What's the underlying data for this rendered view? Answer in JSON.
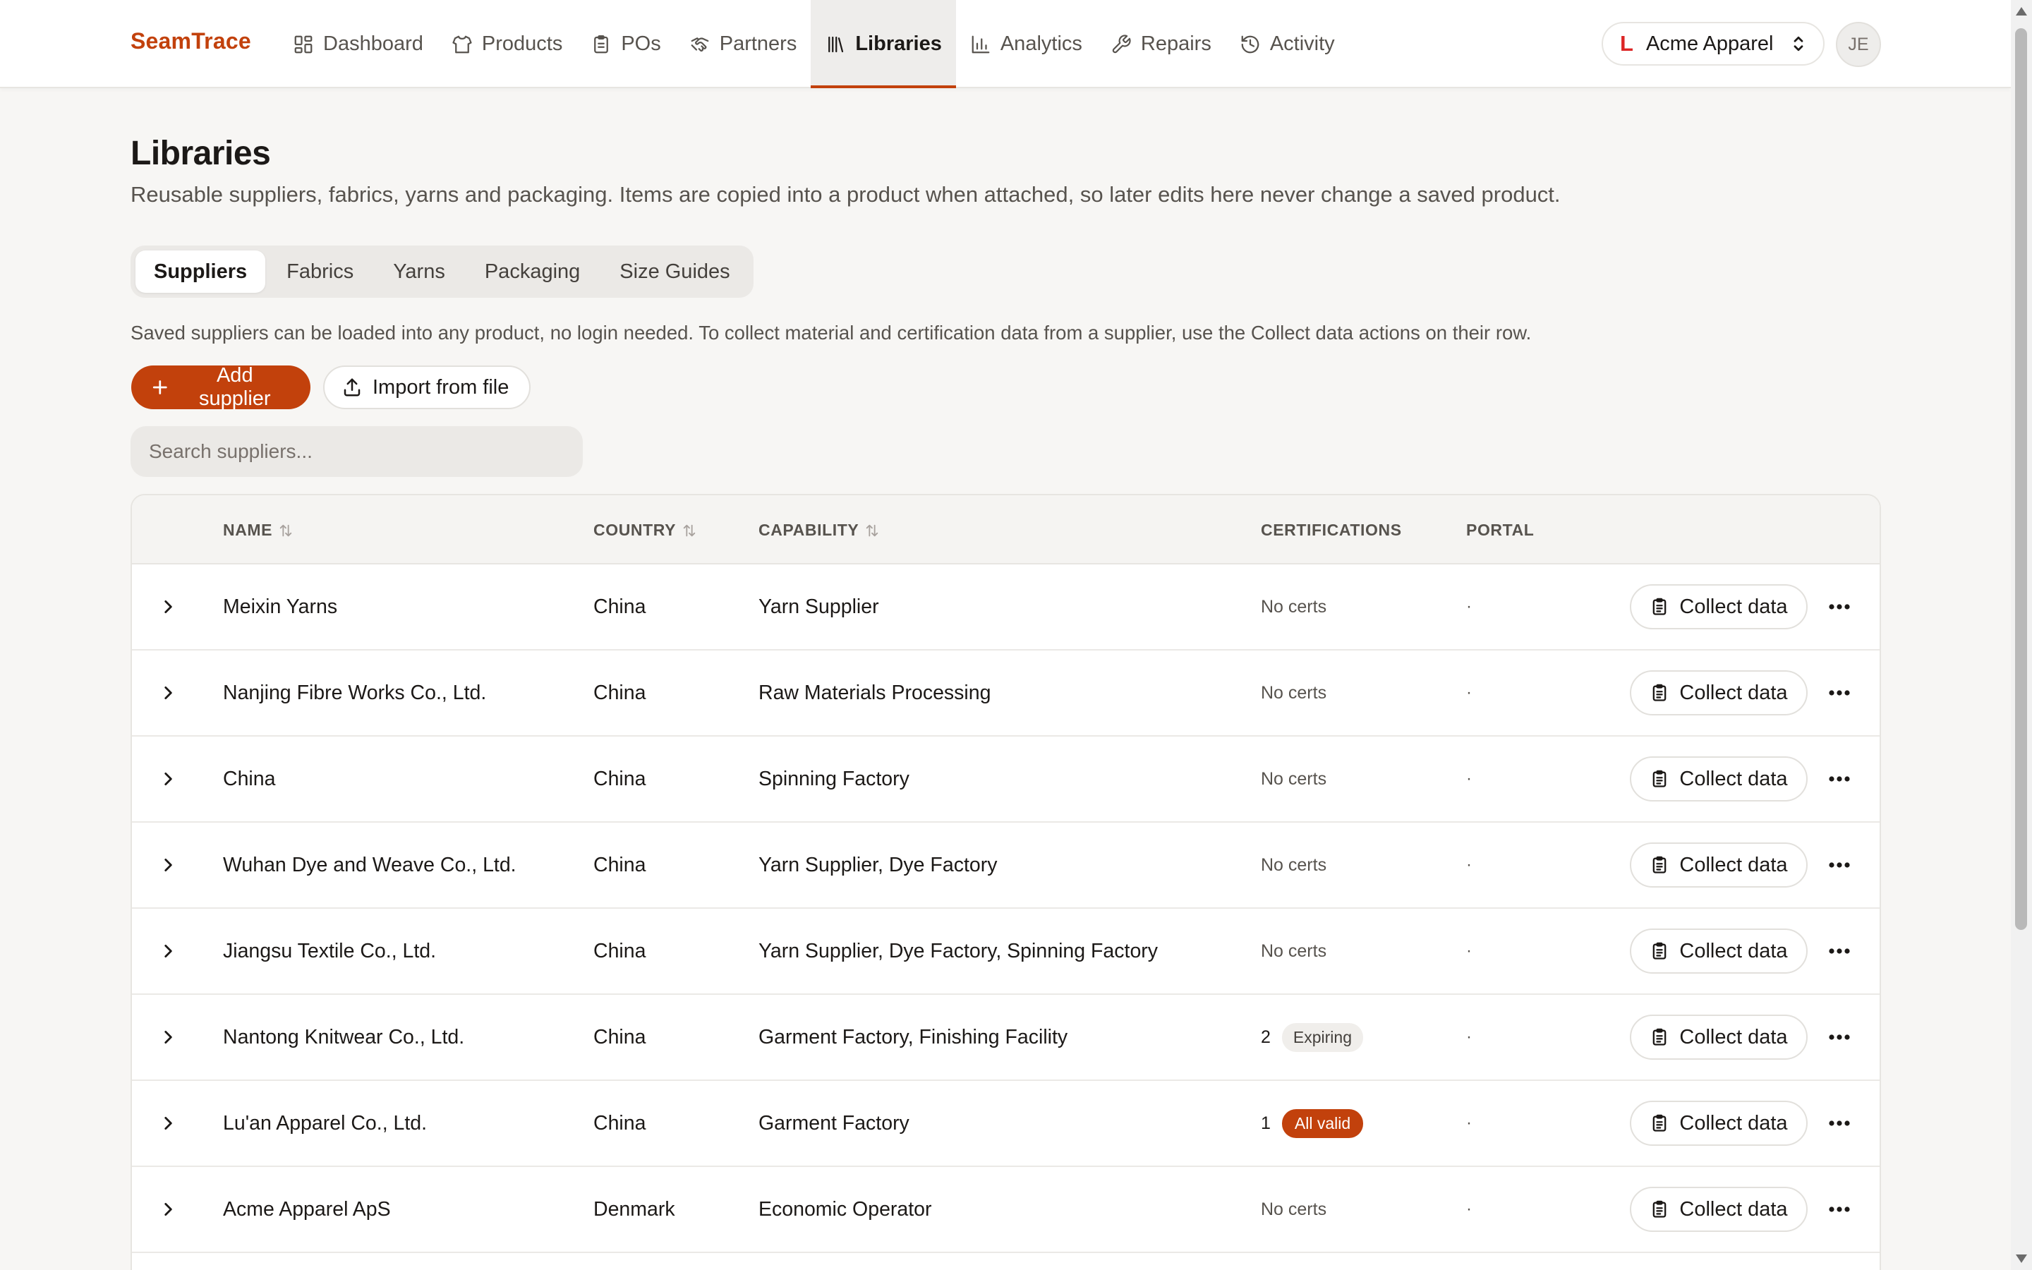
{
  "brand": "SeamTrace",
  "nav": [
    {
      "label": "Dashboard",
      "icon": "dashboard-icon",
      "active": false
    },
    {
      "label": "Products",
      "icon": "shirt-icon",
      "active": false
    },
    {
      "label": "POs",
      "icon": "clipboard-icon",
      "active": false
    },
    {
      "label": "Partners",
      "icon": "handshake-icon",
      "active": false
    },
    {
      "label": "Libraries",
      "icon": "library-icon",
      "active": true
    },
    {
      "label": "Analytics",
      "icon": "bar-chart-icon",
      "active": false
    },
    {
      "label": "Repairs",
      "icon": "wrench-icon",
      "active": false
    },
    {
      "label": "Activity",
      "icon": "history-icon",
      "active": false
    }
  ],
  "org": {
    "logo": "L",
    "name": "Acme Apparel"
  },
  "avatar": "JE",
  "page": {
    "title": "Libraries",
    "subtitle": "Reusable suppliers, fabrics, yarns and packaging. Items are copied into a product when attached, so later edits here never change a saved product."
  },
  "tabs": [
    {
      "label": "Suppliers",
      "active": true
    },
    {
      "label": "Fabrics",
      "active": false
    },
    {
      "label": "Yarns",
      "active": false
    },
    {
      "label": "Packaging",
      "active": false
    },
    {
      "label": "Size Guides",
      "active": false
    }
  ],
  "helper": "Saved suppliers can be loaded into any product, no login needed. To collect material and certification data from a supplier, use the Collect data actions on their row.",
  "actions": {
    "add": "Add supplier",
    "import": "Import from file"
  },
  "search": {
    "placeholder": "Search suppliers..."
  },
  "table": {
    "columns": {
      "name": "NAME",
      "country": "COUNTRY",
      "capability": "CAPABILITY",
      "certifications": "CERTIFICATIONS",
      "portal": "PORTAL"
    },
    "collect_label": "Collect data",
    "rows": [
      {
        "name": "Meixin Yarns",
        "country": "China",
        "capability": "Yarn Supplier",
        "certs": "No certs",
        "cert_count": "",
        "cert_badge": "",
        "badge_style": "",
        "portal": "·"
      },
      {
        "name": "Nanjing Fibre Works Co., Ltd.",
        "country": "China",
        "capability": "Raw Materials Processing",
        "certs": "No certs",
        "cert_count": "",
        "cert_badge": "",
        "badge_style": "",
        "portal": "·"
      },
      {
        "name": "China",
        "country": "China",
        "capability": "Spinning Factory",
        "certs": "No certs",
        "cert_count": "",
        "cert_badge": "",
        "badge_style": "",
        "portal": "·"
      },
      {
        "name": "Wuhan Dye and Weave Co., Ltd.",
        "country": "China",
        "capability": "Yarn Supplier, Dye Factory",
        "certs": "No certs",
        "cert_count": "",
        "cert_badge": "",
        "badge_style": "",
        "portal": "·"
      },
      {
        "name": "Jiangsu Textile Co., Ltd.",
        "country": "China",
        "capability": "Yarn Supplier, Dye Factory, Spinning Factory",
        "certs": "No certs",
        "cert_count": "",
        "cert_badge": "",
        "badge_style": "",
        "portal": "·"
      },
      {
        "name": "Nantong Knitwear Co., Ltd.",
        "country": "China",
        "capability": "Garment Factory, Finishing Facility",
        "certs": "",
        "cert_count": "2",
        "cert_badge": "Expiring",
        "badge_style": "muted",
        "portal": "·"
      },
      {
        "name": "Lu'an Apparel Co., Ltd.",
        "country": "China",
        "capability": "Garment Factory",
        "certs": "",
        "cert_count": "1",
        "cert_badge": "All valid",
        "badge_style": "red",
        "portal": "·"
      },
      {
        "name": "Acme Apparel ApS",
        "country": "Denmark",
        "capability": "Economic Operator",
        "certs": "No certs",
        "cert_count": "",
        "cert_badge": "",
        "badge_style": "",
        "portal": "·"
      }
    ]
  },
  "colors": {
    "accent": "#c2410c",
    "background": "#f7f6f4",
    "text": "#1c1917",
    "muted": "#57534e"
  }
}
